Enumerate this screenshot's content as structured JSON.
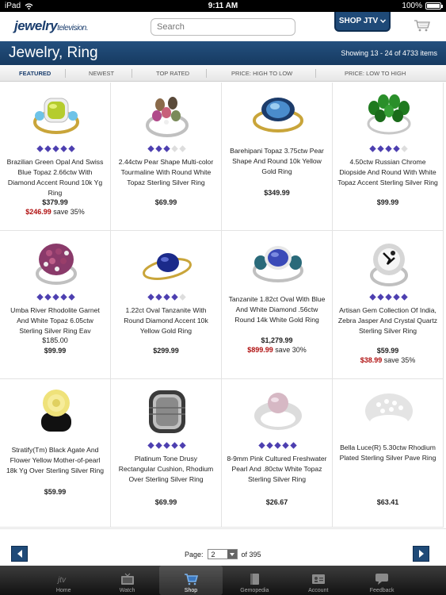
{
  "status_bar": {
    "carrier": "iPad",
    "time": "9:11 AM",
    "battery": "100%"
  },
  "header": {
    "logo_main": "jewelry",
    "logo_sub": "television.",
    "search_placeholder": "Search",
    "shop_label": "SHOP JTV"
  },
  "title": "Jewelry, Ring",
  "results_text": "Showing 13 - 24 of 4733 items",
  "sort_options": [
    "FEATURED",
    "NEWEST",
    "TOP RATED",
    "PRICE: HIGH TO LOW",
    "PRICE: LOW TO HIGH"
  ],
  "products": [
    {
      "name": "Brazilian Green Opal And Swiss Blue Topaz 2.66ctw With Diamond Accent Round 10k Yg Ring",
      "price": "$379.99",
      "sale_price": "$246.99",
      "save": "save 35%",
      "rating": 5
    },
    {
      "name": "2.44ctw Pear Shape Multi-color Tourmaline With Round White Topaz Sterling Silver Ring",
      "price": "$69.99",
      "rating": 3
    },
    {
      "name": "Barehipani Topaz 3.75ctw Pear Shape And Round 10k Yellow Gold Ring",
      "price": "$349.99",
      "rating": 0
    },
    {
      "name": "4.50ctw Russian Chrome Diopside And Round With White Topaz Accent Sterling Silver Ring",
      "price": "$99.99",
      "rating": 4
    },
    {
      "name": "Umba River Rhodolite Garnet And White Topaz 6.05ctw Sterling Silver Ring Eav",
      "price": "$185.00",
      "price2": "$99.99",
      "rating": 5
    },
    {
      "name": "1.22ct Oval Tanzanite With Round Diamond Accent 10k Yellow Gold Ring",
      "price": "$299.99",
      "rating": 4
    },
    {
      "name": "Tanzanite 1.82ct Oval With Blue And White Diamond .56ctw Round 14k White Gold Ring",
      "price": "$1,279.99",
      "sale_price": "$899.99",
      "save": "save 30%",
      "rating": 0
    },
    {
      "name": "Artisan Gem Collection Of India, Zebra Jasper And Crystal Quartz Sterling Silver Ring",
      "price": "$59.99",
      "sale_price": "$38.99",
      "save": "save 35%",
      "rating": 5
    },
    {
      "name": "Stratify(Tm) Black Agate And Flower Yellow Mother-of-pearl 18k Yg Over Sterling Silver Ring",
      "price": "$59.99",
      "rating": 0
    },
    {
      "name": "Platinum Tone Drusy Rectangular Cushion, Rhodium Over Sterling Silver Ring",
      "price": "$69.99",
      "rating": 5
    },
    {
      "name": "8-9mm Pink Cultured Freshwater Pearl And .80ctw White Topaz Sterling Silver Ring",
      "price": "$26.67",
      "rating": 5
    },
    {
      "name": "Bella Luce(R) 5.30ctw Rhodium Plated Sterling Silver Pave Ring",
      "price": "$63.41",
      "rating": 0
    }
  ],
  "pager": {
    "label": "Page:",
    "current": "2",
    "of_text": "of 395"
  },
  "tabs": [
    {
      "label": "Home",
      "icon": "jtv-logo-icon"
    },
    {
      "label": "Watch",
      "icon": "tv-icon"
    },
    {
      "label": "Shop",
      "icon": "cart-icon"
    },
    {
      "label": "Gemopedia",
      "icon": "book-icon"
    },
    {
      "label": "Account",
      "icon": "id-card-icon"
    },
    {
      "label": "Feedback",
      "icon": "speech-bubble-icon"
    }
  ],
  "colors": {
    "brand": "#1f4a78",
    "sale": "#b01010",
    "star": "#4d3fb0"
  }
}
